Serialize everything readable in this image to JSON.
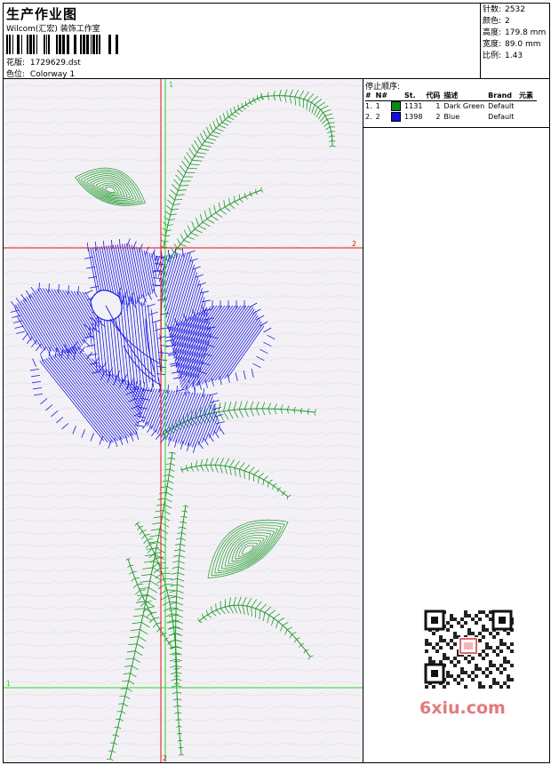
{
  "header": {
    "title": "生产作业图",
    "company": "Wilcom(汇宏) 装饰工作室",
    "design_label": "花版:",
    "design_file": "1729629.dst",
    "colorway_label": "色位:",
    "colorway": "Colorway 1"
  },
  "stats": [
    {
      "label": "针数:",
      "value": "2532"
    },
    {
      "label": "颜色:",
      "value": "2"
    },
    {
      "label": "高度:",
      "value": "179.8 mm"
    },
    {
      "label": "宽度:",
      "value": "89.0 mm"
    },
    {
      "label": "比例:",
      "value": "1.43"
    }
  ],
  "stop_sequence": {
    "title": "停止顺序:",
    "headers": [
      "#",
      "N#",
      "St.",
      "代码",
      "描述",
      "Brand",
      "元素"
    ],
    "rows": [
      {
        "idx": "1.",
        "n": "1",
        "color": "#0a8a18",
        "st": "1131",
        "code": "1",
        "desc": "Dark Green",
        "brand": "Default"
      },
      {
        "idx": "2.",
        "n": "2",
        "color": "#1010d8",
        "st": "1398",
        "code": "2",
        "desc": "Blue",
        "brand": "Default"
      }
    ]
  },
  "canvas": {
    "guide_labels": {
      "top_v": "1",
      "bottom_v": "2",
      "h_upper_right": "2",
      "h_lower_left": "1"
    },
    "guide_colors": {
      "green": "#2bd22b",
      "red": "#e01414"
    },
    "thread_colors": {
      "green": "#1f9a2a",
      "blue": "#1a1ae6"
    }
  },
  "watermark": {
    "text": "6xiu.com"
  }
}
